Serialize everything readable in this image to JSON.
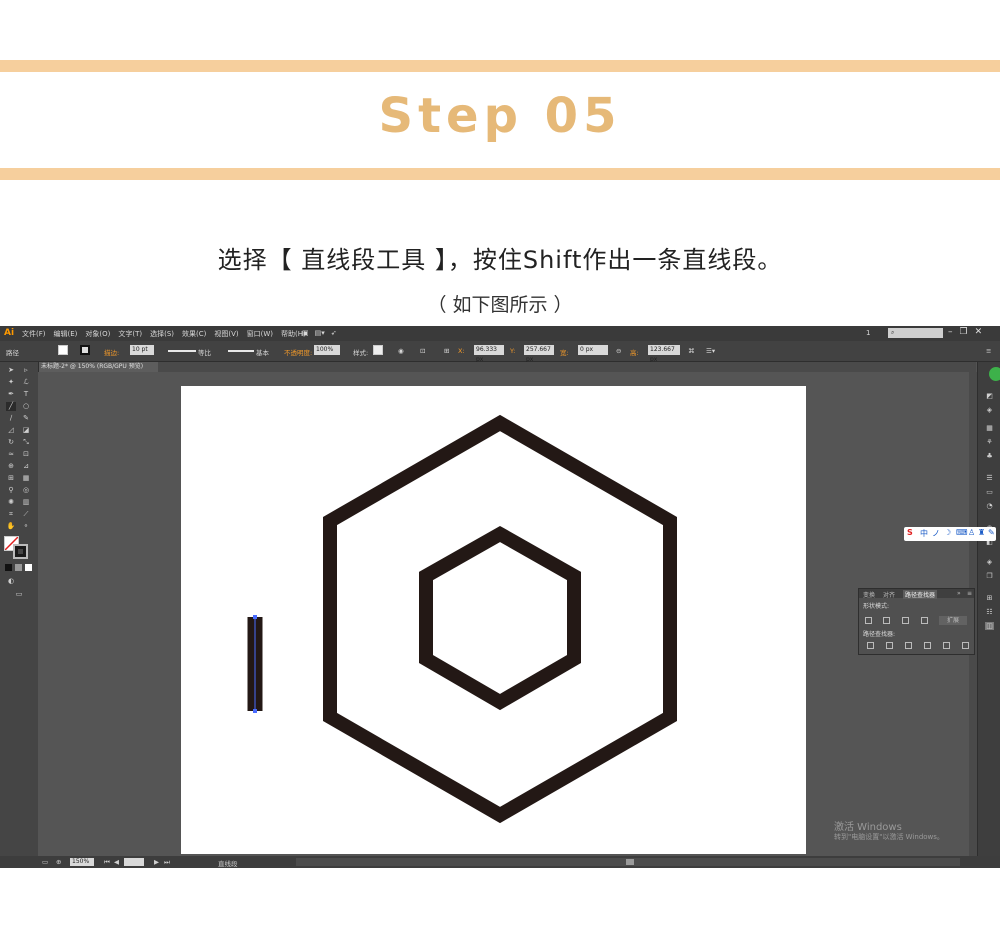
{
  "header": {
    "step_title": "Step 05",
    "accent_color": "#e6b978",
    "band_color": "#f6cf9d"
  },
  "instruction": {
    "main": "选择【 直线段工具 】，按住Shift作出一条直线段。",
    "sub": "（ 如下图所示 ）"
  },
  "app": {
    "logo": "Ai",
    "menu": [
      "文件(F)",
      "编辑(E)",
      "对象(O)",
      "文字(T)",
      "选择(S)",
      "效果(C)",
      "视图(V)",
      "窗口(W)",
      "帮助(H)"
    ],
    "workspace_number": "1",
    "window_controls": [
      "–",
      "❐",
      "✕"
    ]
  },
  "control_bar": {
    "mode": "路径",
    "stroke_label": "描边:",
    "stroke_value": "10 pt",
    "profile_label": "等比",
    "brush_label": "基本",
    "opacity_label": "不透明度:",
    "opacity_value": "100%",
    "style_label": "样式:",
    "x_label": "X:",
    "x_value": "96.333 px",
    "y_label": "Y:",
    "y_value": "257.667 px",
    "w_label": "宽:",
    "w_value": "0 px",
    "h_label": "高:",
    "h_value": "123.667 px"
  },
  "document": {
    "tab_title": "未标题-2* @ 150% (RGB/GPU 预览)"
  },
  "pathfinder": {
    "tabs": [
      "变换",
      "对齐",
      "路径查找器"
    ],
    "active_tab": "路径查找器",
    "shape_modes_label": "形状模式:",
    "expand_label": "扩展",
    "pathfinders_label": "路径查找器:"
  },
  "watermark": {
    "line1": "激活 Windows",
    "line2": "转到\"电脑设置\"以激活 Windows。"
  },
  "status": {
    "zoom": "150%",
    "tool": "直线段"
  },
  "artwork": {
    "stroke_color": "#231815",
    "selection_color": "#4a6cff"
  }
}
